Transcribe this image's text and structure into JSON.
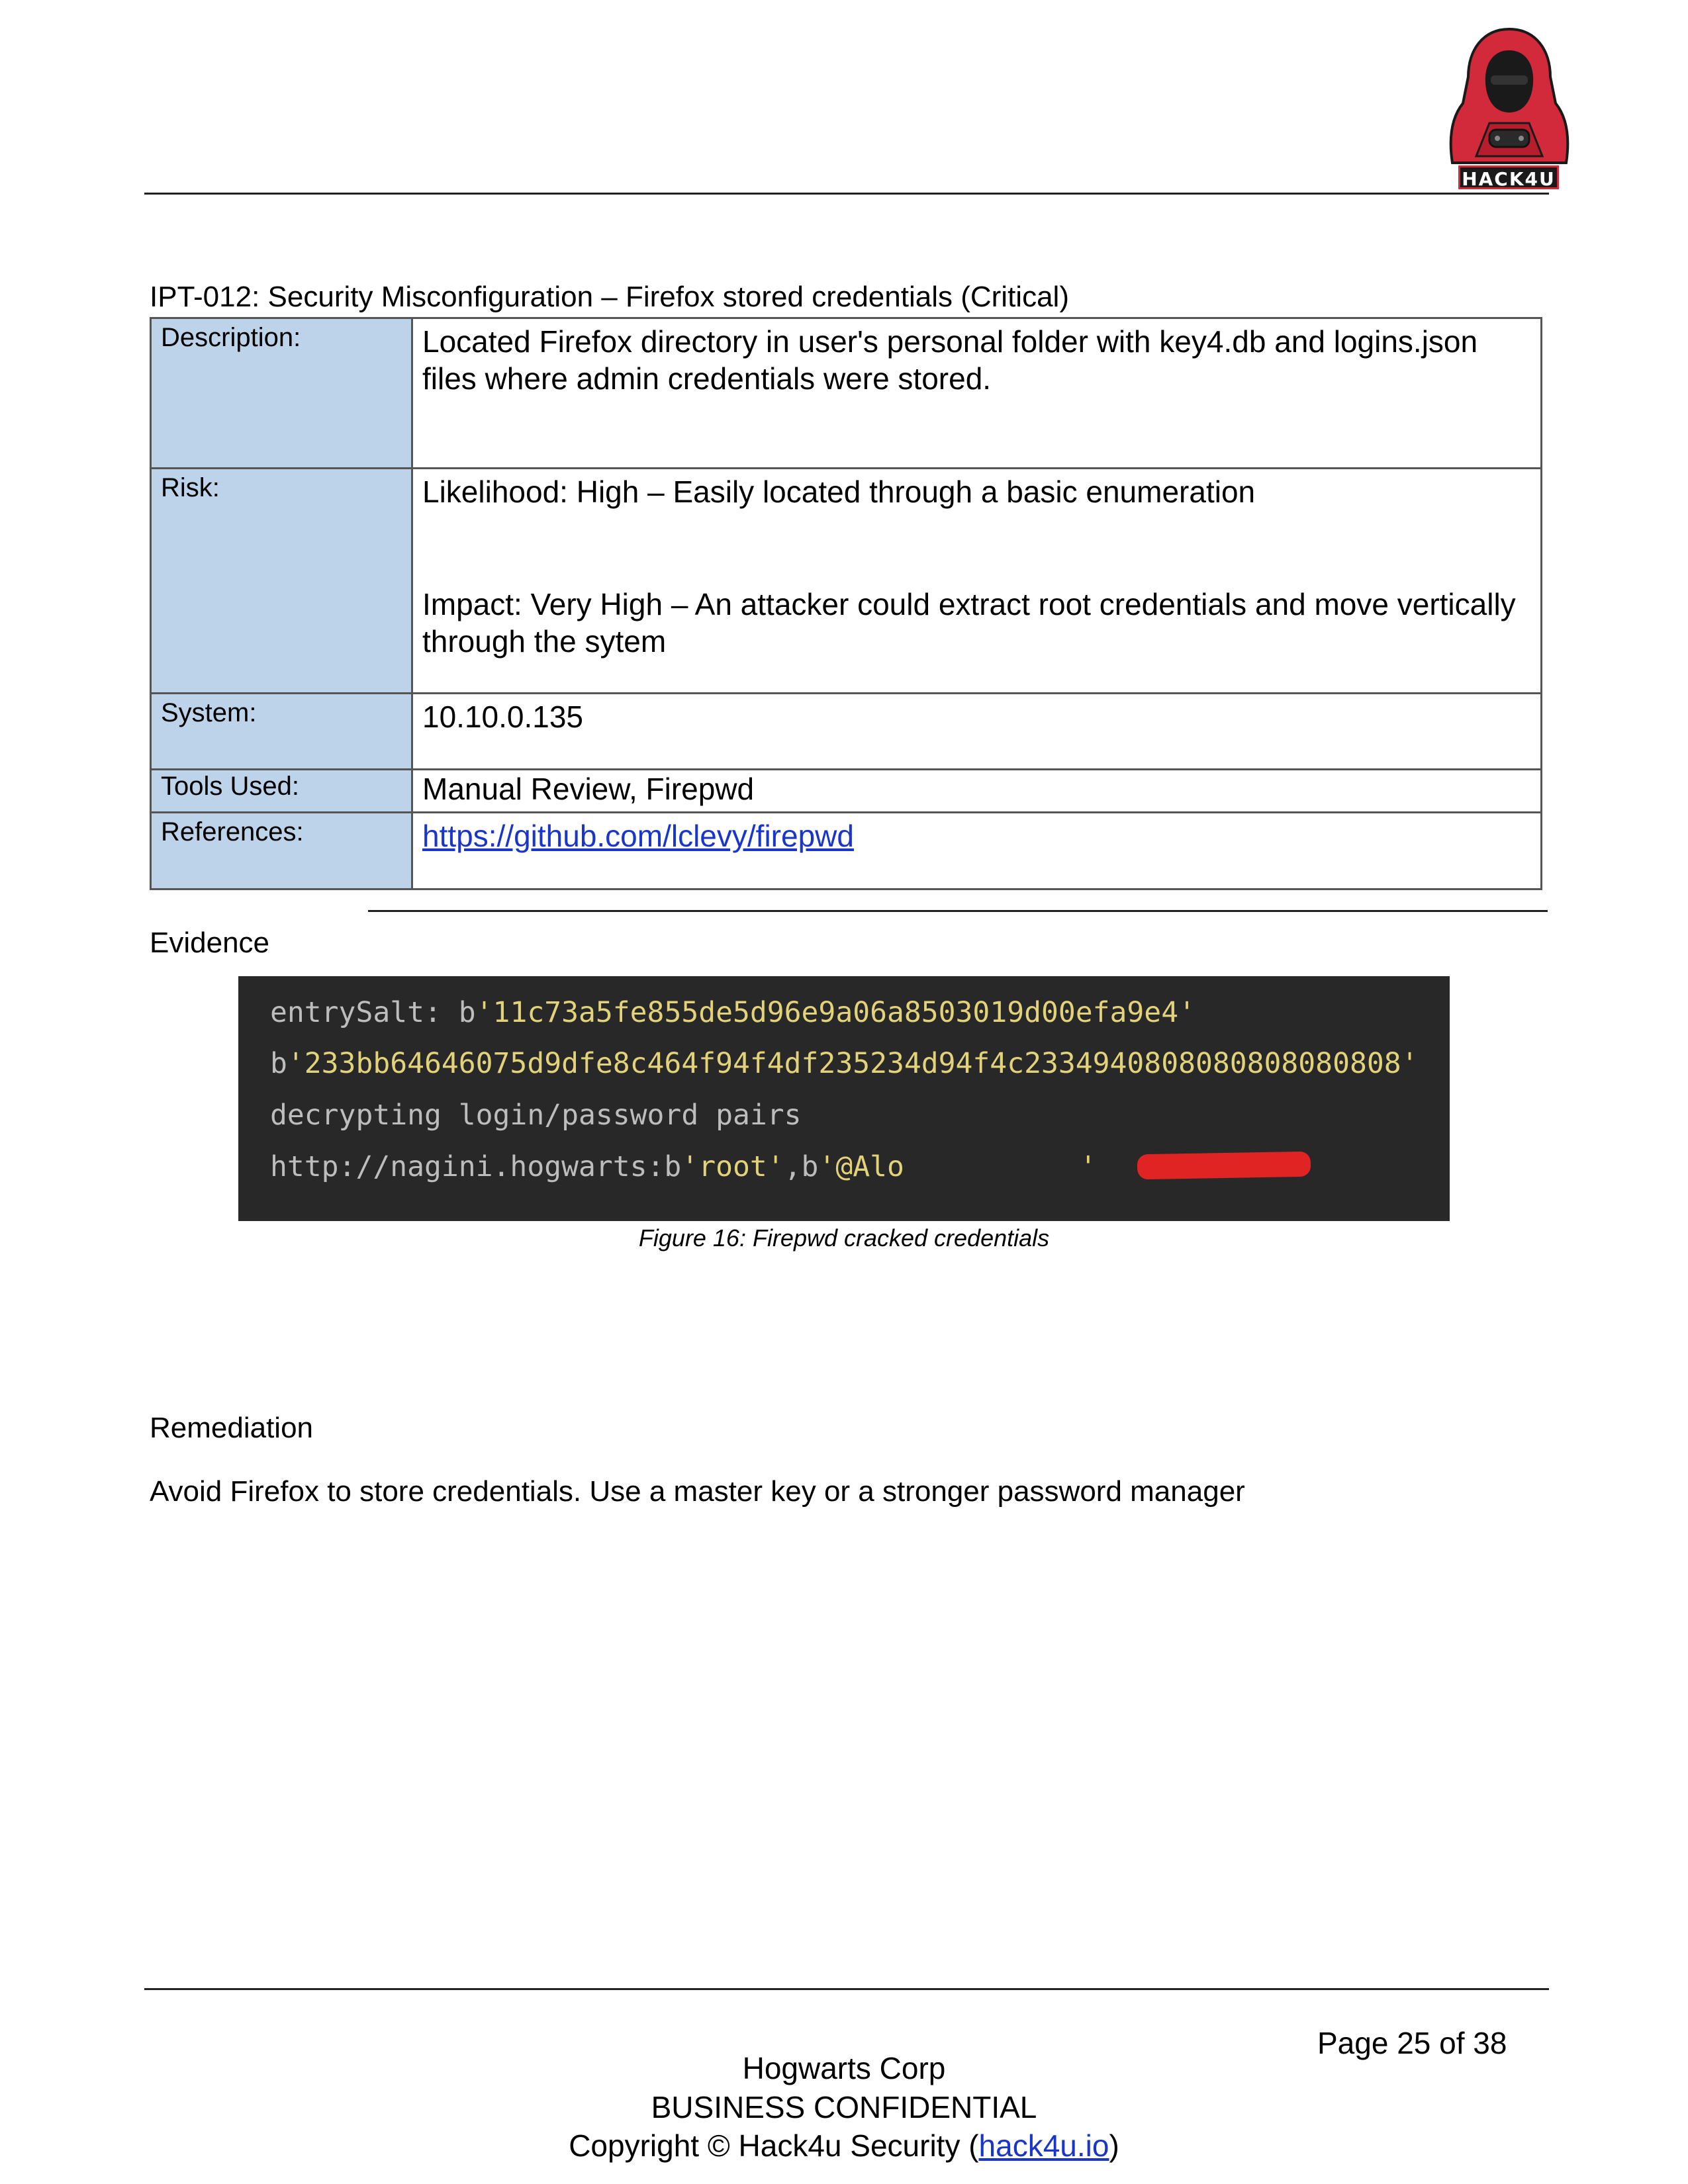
{
  "header": {
    "logo_text": "HACK4U"
  },
  "finding": {
    "title": "IPT-012: Security Misconfiguration – Firefox stored credentials (Critical)",
    "rows": [
      {
        "label": "Description:",
        "value": "Located Firefox directory in user's personal folder with key4.db and logins.json files where admin credentials were stored."
      },
      {
        "label": "Risk:",
        "likelihood": "Likelihood: High – Easily located through a basic enumeration",
        "impact": "Impact: Very High – An attacker could extract root credentials and move vertically through the sytem"
      },
      {
        "label": "System:",
        "value": "10.10.0.135"
      },
      {
        "label": "Tools Used:",
        "value": "Manual Review, Firepwd"
      },
      {
        "label": "References:",
        "link": "https://github.com/lclevy/firepwd"
      }
    ]
  },
  "evidence": {
    "heading": "Evidence",
    "code": {
      "line1_prefix": "entrySalt: b",
      "line1_str": "'11c73a5fe855de5d96e9a06a8503019d00efa9e4'",
      "line2_prefix": "b",
      "line2_str": "'233bb64646075d9dfe8c464f94f4df235234d94f4c2334940808080808080808'",
      "line3": "decrypting login/password pairs",
      "line4_prefix": "http://nagini.hogwarts:b",
      "line4_user": "'root'",
      "line4_mid": ",b",
      "line4_pass": "'@Alo",
      "line4_end": "'"
    },
    "caption": "Figure 16: Firepwd cracked credentials"
  },
  "remediation": {
    "heading": "Remediation",
    "text": "Avoid Firefox to store credentials. Use a master key or a stronger password manager"
  },
  "footer": {
    "page": "Page 25 of 38",
    "company": "Hogwarts Corp",
    "confidential": "BUSINESS CONFIDENTIAL",
    "copyright_prefix": "Copyright © Hack4u Security (",
    "copyright_link": "hack4u.io",
    "copyright_suffix": ")"
  },
  "colors": {
    "label_bg": "#bdd3ea",
    "link": "#1a35c9",
    "code_bg": "#282828",
    "code_string": "#e2d27a",
    "redaction": "#e02424",
    "logo_red": "#d22a3a"
  }
}
